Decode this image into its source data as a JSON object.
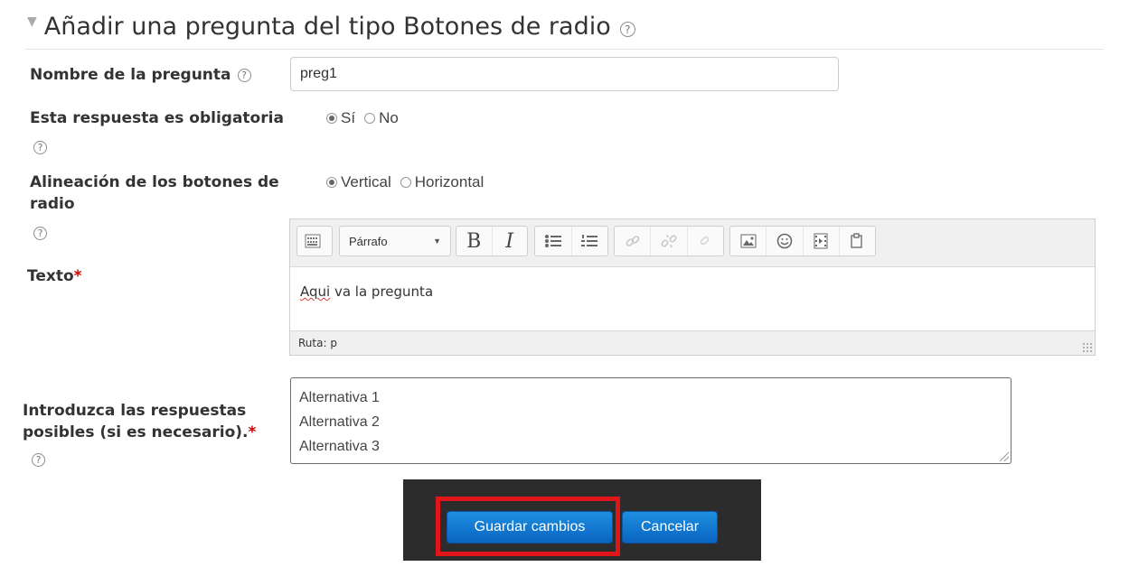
{
  "section": {
    "title": "Añadir una pregunta del tipo Botones de radio"
  },
  "fields": {
    "name": {
      "label": "Nombre de la pregunta",
      "value": "preg1"
    },
    "required": {
      "label": "Esta respuesta es obligatoria",
      "options": [
        "Sí",
        "No"
      ],
      "selected": "Sí"
    },
    "alignment": {
      "label_line1": "Alineación de los botones de",
      "label_line2": "radio",
      "options": [
        "Vertical",
        "Horizontal"
      ],
      "selected": "Vertical"
    },
    "text": {
      "label": "Texto",
      "required_mark": "*",
      "format": "Párrafo",
      "content_word1": "Aqui",
      "content_rest": " va la pregunta",
      "path": "Ruta: p"
    },
    "answers": {
      "label_line1": "Introduzca las respuestas",
      "label_line2": "posibles (si es necesario).",
      "required_mark": "*",
      "lines": [
        "Alternativa 1",
        "Alternativa 2",
        "Alternativa 3"
      ]
    }
  },
  "toolbar": {
    "icons": [
      "toolbar-toggle-icon",
      "bold-icon",
      "italic-icon",
      "unordered-list-icon",
      "ordered-list-icon",
      "link-icon",
      "unlink-icon",
      "anchor-icon",
      "image-icon",
      "emoticon-icon",
      "media-icon",
      "paste-icon"
    ],
    "bold": "B",
    "italic": "I"
  },
  "buttons": {
    "save": "Guardar cambios",
    "cancel": "Cancelar"
  },
  "colors": {
    "accent_blue": "#0a64c0",
    "required_red": "#cc0000",
    "highlight_red": "#e0161b",
    "footer_bg": "#2c2c2c"
  }
}
